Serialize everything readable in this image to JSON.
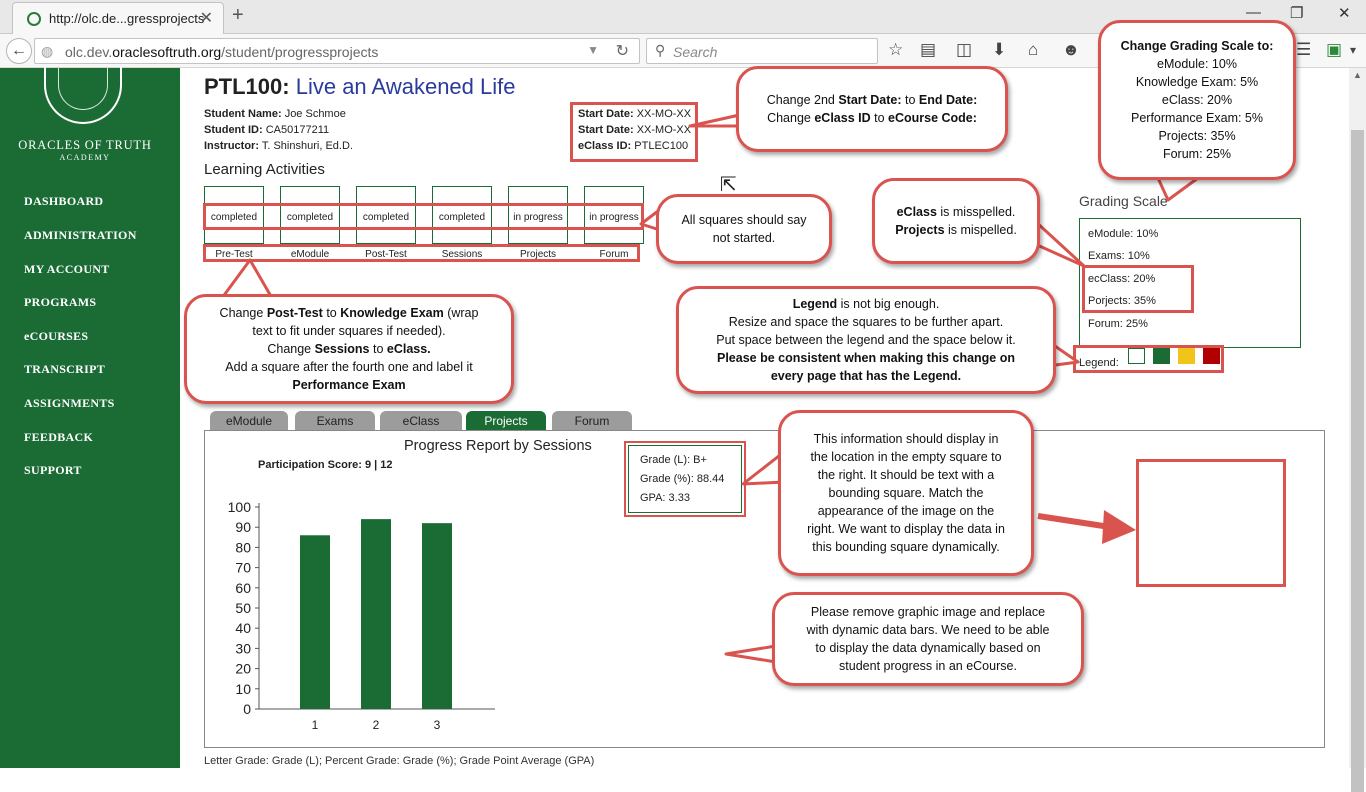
{
  "browser": {
    "tab_title": "http://olc.de...gressprojects",
    "url_domain_prefix": "olc.dev.",
    "url_domain": "oraclesoftruth.org",
    "url_path": "/student/progressprojects",
    "search_placeholder": "Search"
  },
  "sidebar": {
    "brand": "ORACLES OF TRUTH",
    "brand_sub": "ACADEMY",
    "items": [
      "DASHBOARD",
      "ADMINISTRATION",
      "MY ACCOUNT",
      "PROGRAMS",
      "eCOURSES",
      "TRANSCRIPT",
      "ASSIGNMENTS",
      "FEEDBACK",
      "SUPPORT"
    ]
  },
  "course": {
    "code": "PTL100:",
    "name": "Live an Awakened Life"
  },
  "student": {
    "name_label": "Student Name:",
    "name": "Joe Schmoe",
    "id_label": "Student ID:",
    "id": "CA50177211",
    "instructor_label": "Instructor:",
    "instructor": "T. Shinshuri, Ed.D."
  },
  "dates": {
    "start1_label": "Start Date:",
    "start1": "XX-MO-XX",
    "start2_label": "Start Date:",
    "start2": "XX-MO-XX",
    "eclass_label": "eClass ID:",
    "eclass": "PTLEC100"
  },
  "learning": {
    "title": "Learning Activities",
    "squares": [
      {
        "status": "completed",
        "label": "Pre-Test"
      },
      {
        "status": "completed",
        "label": "eModule"
      },
      {
        "status": "completed",
        "label": "Post-Test"
      },
      {
        "status": "completed",
        "label": "Sessions"
      },
      {
        "status": "in progress",
        "label": "Projects"
      },
      {
        "status": "in progress",
        "label": "Forum"
      }
    ]
  },
  "grading": {
    "title": "Grading Scale",
    "items": [
      "eModule: 10%",
      "Exams: 10%",
      "ecClass: 20%",
      "Porjects: 35%",
      "Forum: 25%"
    ],
    "legend_label": "Legend:",
    "legend_colors": [
      "#ffffff",
      "#1b6b35",
      "#f0c419",
      "#b00000"
    ]
  },
  "tabs": [
    "eModule",
    "Exams",
    "eClass",
    "Projects",
    "Forum"
  ],
  "active_tab": "Projects",
  "report": {
    "title": "Progress Report by Sessions",
    "participation": "Participation Score: 9 | 12"
  },
  "chart_data": {
    "type": "bar",
    "categories": [
      "1",
      "2",
      "3"
    ],
    "values": [
      86,
      94,
      92
    ],
    "y_ticks": [
      "0",
      "10",
      "20",
      "30",
      "40",
      "50",
      "60",
      "70",
      "80",
      "90",
      "100"
    ],
    "ylim": [
      0,
      100
    ],
    "title": "Progress Report by Sessions",
    "bar_color": "#1b6b35"
  },
  "grades": {
    "letter": "Grade (L):  B+",
    "percent": "Grade (%): 88.44",
    "gpa": "GPA: 3.33"
  },
  "footnote": "Letter Grade: Grade (L); Percent Grade: Grade (%); Grade Point Average (GPA)",
  "callouts": {
    "grading_scale": {
      "heading": "Change Grading Scale to:",
      "lines": [
        "eModule: 10%",
        "Knowledge Exam: 5%",
        "eClass: 20%",
        "Performance Exam: 5%",
        "Projects: 35%",
        "Forum: 25%"
      ]
    },
    "dates": {
      "l1a": "Change 2nd ",
      "l1b": "Start Date:",
      "l1c": " to ",
      "l1d": "End Date:",
      "l2a": "Change ",
      "l2b": "eClass ID",
      "l2c": " to ",
      "l2d": "eCourse Code:"
    },
    "misspell": {
      "l1a": "eClass",
      "l1b": " is misspelled.",
      "l2a": "Projects",
      "l2b": " is mispelled."
    },
    "squares": {
      "l1": "All squares should say",
      "l2": "not started."
    },
    "legend": {
      "l1a": "Legend",
      "l1b": " is not big enough.",
      "l2": "Resize and space the squares to be further apart.",
      "l3": "Put space between the legend and the space below it.",
      "l4": "Please be consistent when making this change on",
      "l5": "every page that has the Legend."
    },
    "post_test": {
      "l1a": "Change ",
      "l1b": "Post-Test",
      "l1c": " to ",
      "l1d": "Knowledge Exam",
      "l1e": " (wrap",
      "l2": "text to fit under squares if needed).",
      "l3a": "Change ",
      "l3b": "Sessions",
      "l3c": " to ",
      "l3d": "eClass.",
      "l4": "Add a square after the fourth one and label it",
      "l5": "Performance Exam"
    },
    "info_display": {
      "lines": [
        "This information should display in",
        "the location in the empty square to",
        "the right. It should be text with a",
        "bounding square. Match the",
        "appearance of the image on the",
        "right. We want to display the data in",
        "this bounding square dynamically."
      ]
    },
    "remove_graphic": {
      "lines": [
        "Please remove graphic image and replace",
        "with dynamic data bars. We need to be able",
        "to display the data dynamically based on",
        "student progress in an eCourse."
      ]
    }
  }
}
